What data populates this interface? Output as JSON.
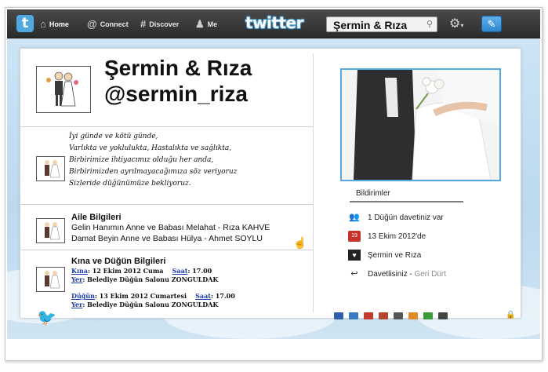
{
  "nav": {
    "home": "Home",
    "connect": "Connect",
    "discover": "Discover",
    "me": "Me",
    "logo": "twitter",
    "search_value": "Şermin & Rıza"
  },
  "profile": {
    "name": "Şermin & Rıza",
    "handle": "@sermin_riza"
  },
  "poem": [
    "İyi günde ve kötü günde,",
    "Varlıkta ve yoklulukta, Hastalıkta ve sağlıkta,",
    "Birbirimize ihtiyacımız olduğu her anda,",
    "Birbirimizden ayrılmayacağımıza söz veriyoruz",
    "Sizleride düğünümüze bekliyoruz."
  ],
  "family": {
    "title": "Aile  Bilgileri",
    "bride_row": "Gelin Hanımın Anne ve Babası  Melahat - Rıza KAHVE",
    "groom_row": "Damat Beyin Anne ve Babası  Hülya - Ahmet SOYLU"
  },
  "events": {
    "title": "Kına ve Düğün Bilgileri",
    "kina_label": "Kına",
    "kina_date": ": 12 Ekim 2012 Cuma",
    "kina_time_label": "Saat",
    "kina_time": ": 17.00",
    "kina_place_label": "Yer",
    "kina_place": ": Belediye Düğün Salonu ZONGULDAK",
    "dugun_label": "Düğün",
    "dugun_date": ": 13 Ekim 2012 Cumartesi",
    "dugun_time_label": "Saat",
    "dugun_time": ": 17.00",
    "dugun_place_label": "Yer",
    "dugun_place": ": Belediye Düğün Salonu ZONGULDAK"
  },
  "notifications": {
    "title": "Bildirimler",
    "items": [
      {
        "icon": "people-icon",
        "text": "1 Düğün davetiniz var"
      },
      {
        "icon": "calendar-icon",
        "text": "13 Ekim 2012'de"
      },
      {
        "icon": "couple-icon",
        "text": "Şermin ve Rıza"
      },
      {
        "icon": "reply-icon",
        "text": "Davetlisiniz - ",
        "link": "Geri Dürt"
      }
    ]
  },
  "colors": {
    "accent": "#55a8e0",
    "link": "#1a3aa8"
  }
}
